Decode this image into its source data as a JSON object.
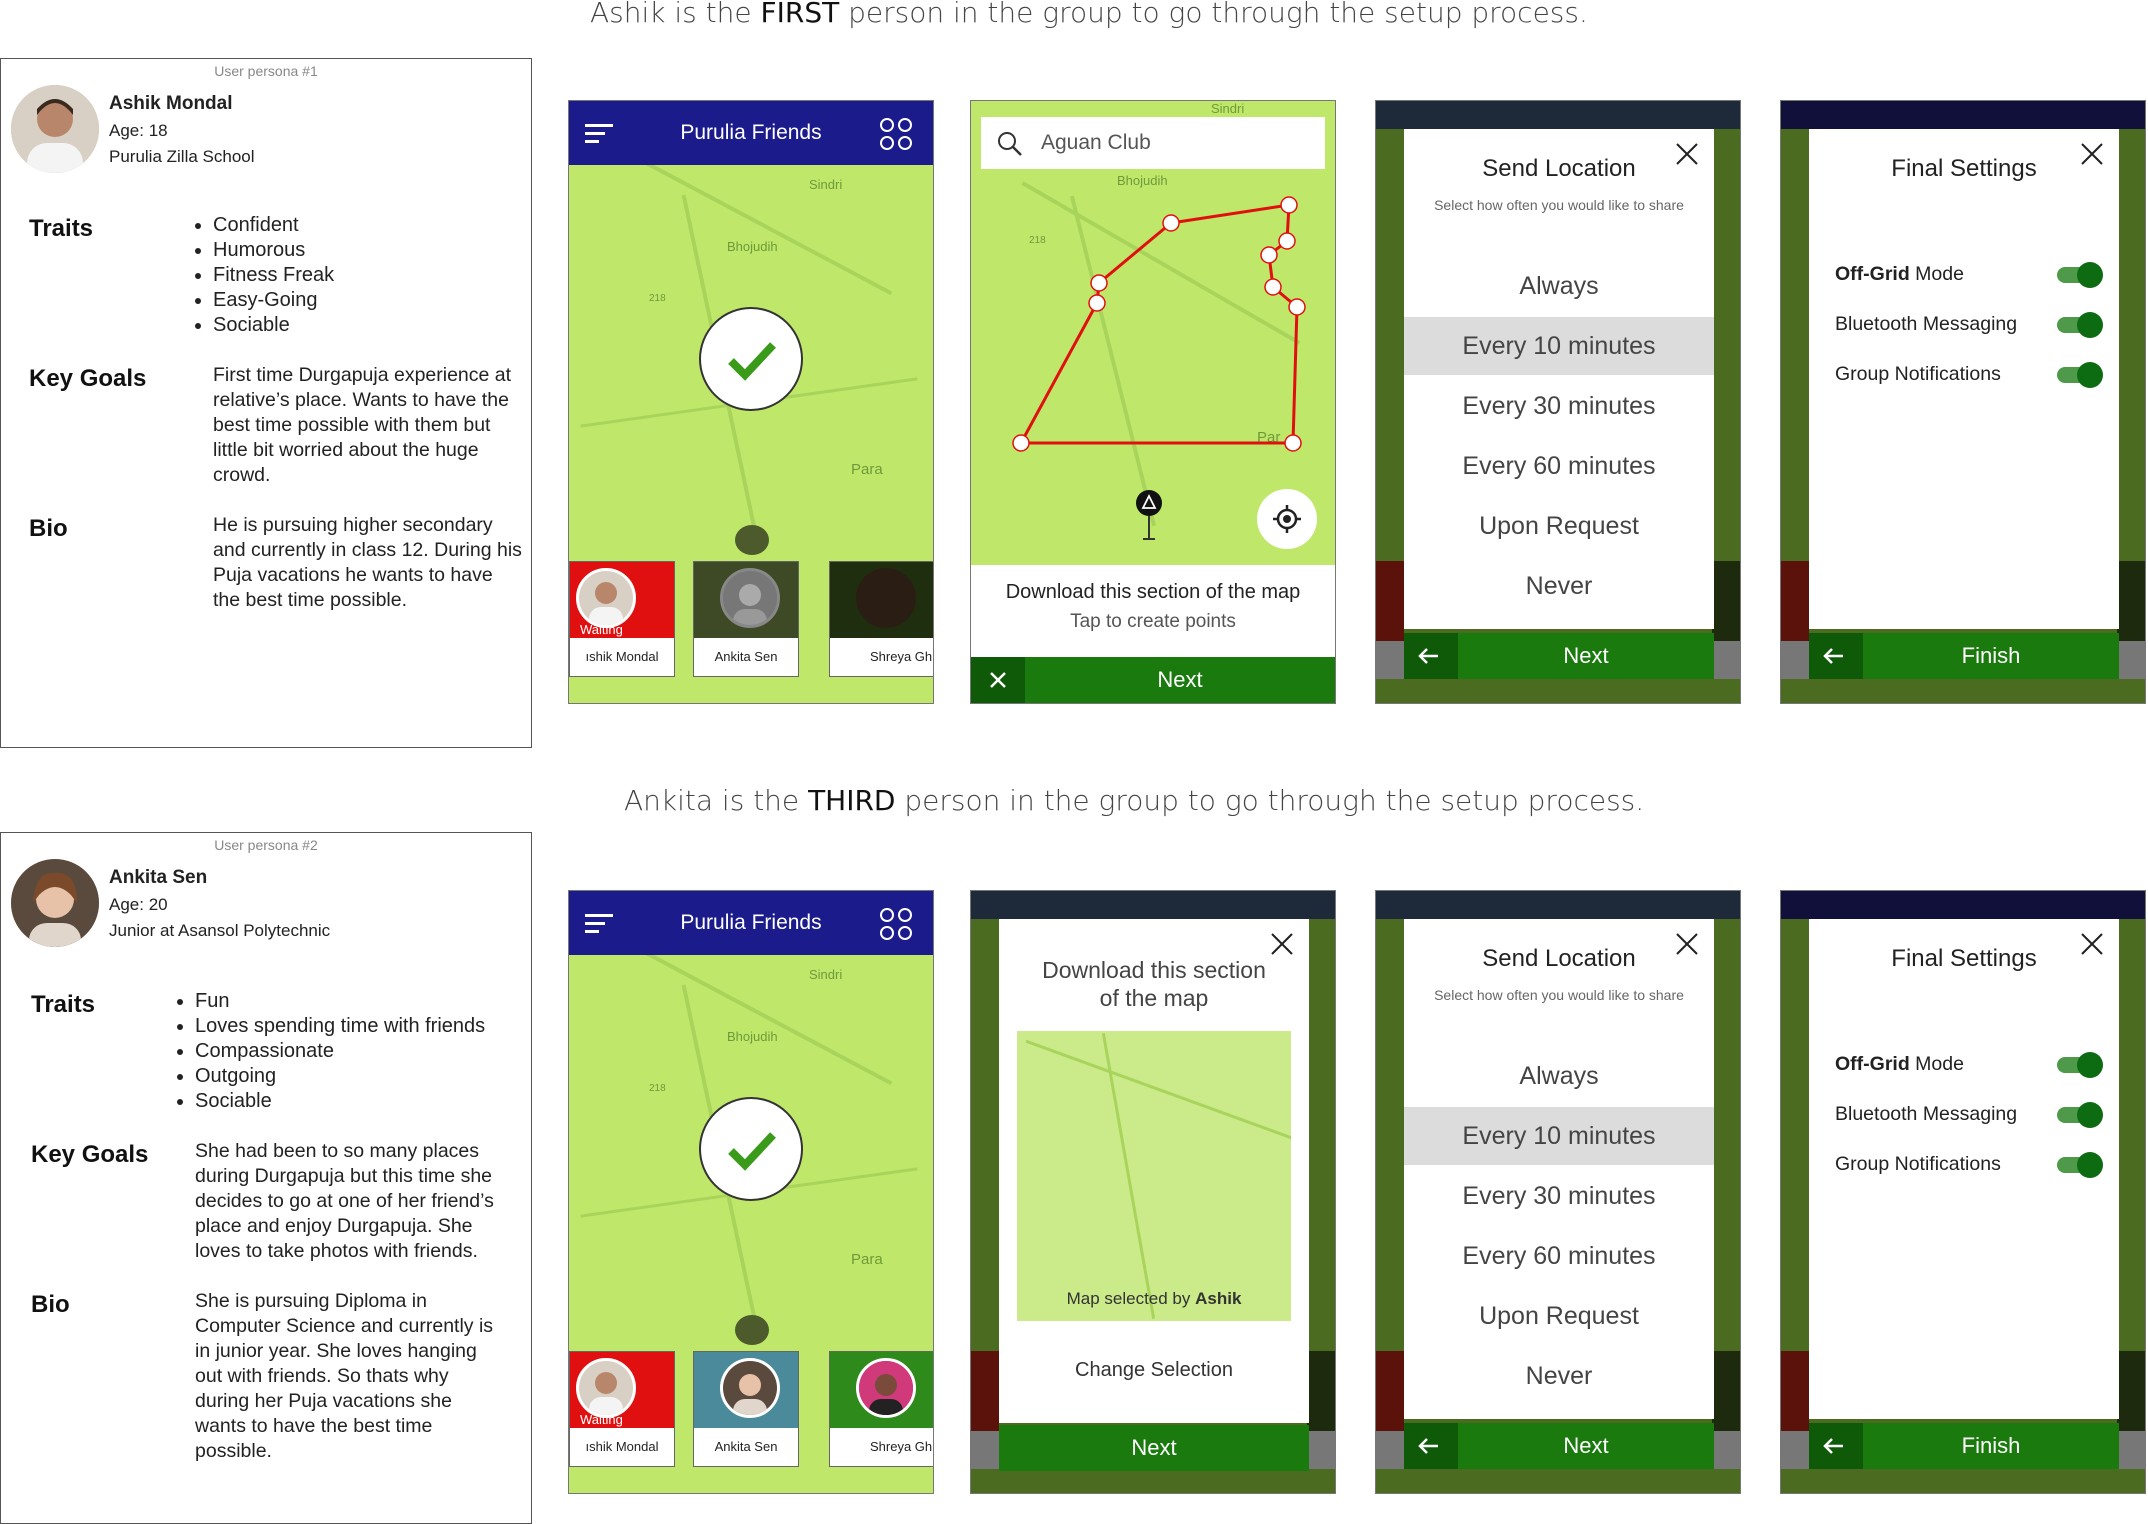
{
  "headings": {
    "row1_pre": "Ashik is the ",
    "row1_em": "FIRST",
    "row1_post": " person  in the group to go through the setup process.",
    "row2_pre": "Ankita is the ",
    "row2_em": "THIRD",
    "row2_post": " person  in the group to go through the setup process."
  },
  "persona1": {
    "tag": "User persona #1",
    "name": "Ashik Mondal",
    "age": "Age:  18",
    "school": "Purulia Zilla School",
    "traits_label": "Traits",
    "traits": [
      "Confident",
      "Humorous",
      "Fitness Freak",
      "Easy-Going",
      "Sociable"
    ],
    "goals_label": "Key Goals",
    "goals": "First time Durgapuja experience at relative’s place. Wants to have the best time possible with them but little bit worried about the huge crowd.",
    "bio_label": "Bio",
    "bio": "He is pursuing higher secondary and currently in class 12. During his Puja vacations he wants to have the best time possible."
  },
  "persona2": {
    "tag": "User persona #2",
    "name": "Ankita Sen",
    "age": "Age:  20",
    "school": "Junior at Asansol Polytechnic",
    "traits_label": "Traits",
    "traits": [
      "Fun",
      "Loves spending time with friends",
      "Compassionate",
      "Outgoing",
      "Sociable"
    ],
    "goals_label": "Key Goals",
    "goals": "She had been to so many places during Durgapuja but this time she decides to go at one of her friend’s place and enjoy Durgapuja. She loves to take photos with friends.",
    "bio_label": "Bio",
    "bio": "She is pursuing Diploma in Computer Science and currently is in junior year. She loves hanging out with friends. So thats why during her Puja vacations she wants to have the best time possible."
  },
  "group_screen": {
    "title": "Purulia Friends",
    "map_labels": [
      "Sindri",
      "Bhojudih",
      "218",
      "Para"
    ],
    "members": [
      "ıshik Mondal",
      "Ankita Sen",
      "Shreya Gh"
    ],
    "waiting": "Waiting"
  },
  "map_select": {
    "search_value": "Aguan Club",
    "map_labels": [
      "Sindri",
      "Bhojudih",
      "218",
      "Par"
    ],
    "download_text": "Download this section of the map",
    "tap_text": "Tap to create points",
    "next": "Next"
  },
  "map_download": {
    "title_line1": "Download this section",
    "title_line2": "of the map",
    "selected_pre": "Map selected by ",
    "selected_by": "Ashik",
    "change": "Change Selection",
    "next": "Next"
  },
  "send_location": {
    "title": "Send Location",
    "subtitle": "Select how often you would like to share",
    "options": [
      "Always",
      "Every 10 minutes",
      "Every 30 minutes",
      "Every 60 minutes",
      "Upon Request",
      "Never"
    ],
    "next": "Next",
    "header_ghost": "Purulia Friends"
  },
  "final_settings": {
    "title": "Final Settings",
    "settings": [
      {
        "bold": "Off-Grid",
        "rest": " Mode"
      },
      {
        "bold": "",
        "rest": "Bluetooth Messaging"
      },
      {
        "bold": "",
        "rest": "Group Notifications"
      }
    ],
    "finish": "Finish"
  },
  "colors": {
    "map": "#bfe86a",
    "header": "#1b1b8c",
    "green_button": "#1a7a0e",
    "waiting_red": "#e01010",
    "route_red": "#e01010"
  }
}
